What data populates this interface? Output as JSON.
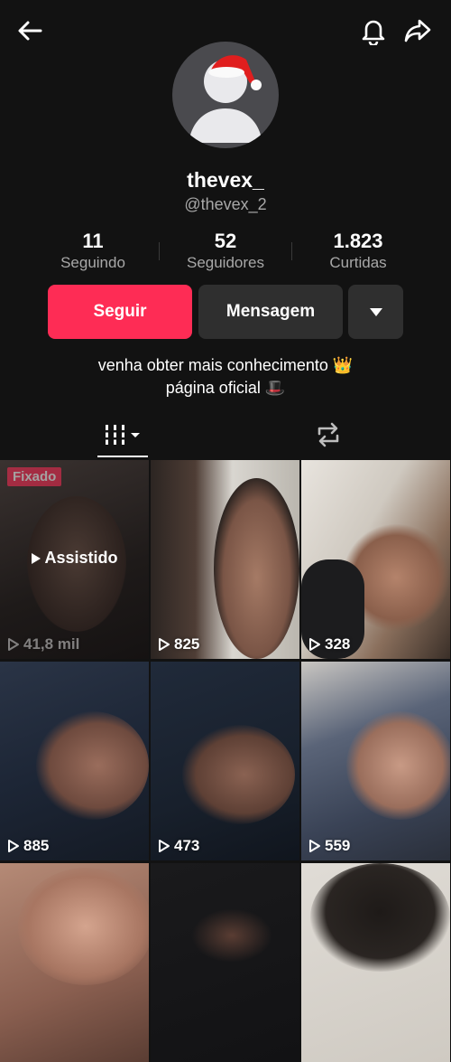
{
  "profile": {
    "username": "thevex_",
    "handle": "@thevex_2",
    "stats": [
      {
        "value": "11",
        "label": "Seguindo"
      },
      {
        "value": "52",
        "label": "Seguidores"
      },
      {
        "value": "1.823",
        "label": "Curtidas"
      }
    ],
    "bio_line1": "venha obter mais conhecimento 👑",
    "bio_line2": "página oficial 🎩"
  },
  "actions": {
    "follow_label": "Seguir",
    "message_label": "Mensagem"
  },
  "icons": {
    "back": "back-arrow-icon",
    "bell": "bell-icon",
    "share": "share-icon",
    "grid": "videos-grid-icon",
    "repost": "repost-icon",
    "play": "play-icon"
  },
  "colors": {
    "background": "#121212",
    "follow": "#fe2c55",
    "secondary_button": "#2f2f2f"
  },
  "videos": [
    {
      "views": "41,8 mil",
      "pinned_label": "Fixado",
      "watched_label": "Assistido"
    },
    {
      "views": "825"
    },
    {
      "views": "328"
    },
    {
      "views": "885"
    },
    {
      "views": "473"
    },
    {
      "views": "559"
    },
    {
      "views": ""
    },
    {
      "views": ""
    },
    {
      "views": ""
    }
  ]
}
